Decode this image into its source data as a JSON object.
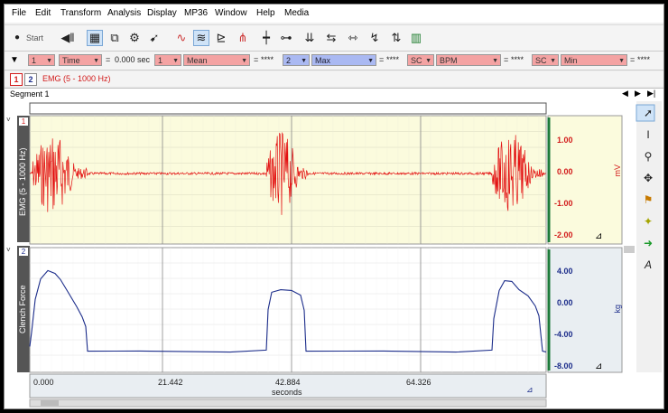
{
  "menu": [
    "File",
    "Edit",
    "Transform",
    "Analysis",
    "Display",
    "MP36",
    "Window",
    "Help",
    "Media"
  ],
  "toolbar": {
    "start_label": "Start",
    "icons": [
      "start-icon",
      "rewind-icon",
      "grid-icon",
      "graph-select-icon",
      "gear-icon",
      "pointer-wand-icon",
      "waveform-icon",
      "overlap-icon",
      "chart-icon",
      "split-icon",
      "marker-icon",
      "nodes-icon",
      "compress-icon",
      "expand-icon",
      "stretch-icon",
      "recycle-icon",
      "bar-chart-icon"
    ]
  },
  "measurements": [
    {
      "channel": "1",
      "measure": "Time",
      "value": "0.000 sec",
      "style": "red"
    },
    {
      "channel": "1",
      "measure": "Mean",
      "value": "****",
      "style": "red"
    },
    {
      "channel": "2",
      "measure": "Max",
      "value": "****",
      "style": "blue"
    },
    {
      "channel": "SC",
      "measure": "BPM",
      "value": "****",
      "style": "red"
    },
    {
      "channel": "SC",
      "measure": "Min",
      "value": "****",
      "style": "red"
    }
  ],
  "channels_row": {
    "ch1": "1",
    "ch2": "2",
    "label": "EMG (5 - 1000 Hz)",
    "label_color": "#d21a1a"
  },
  "segment": {
    "label": "Segment 1"
  },
  "ch1": {
    "number": "1",
    "name": "EMG (5 - 1000 Hz)",
    "unit": "mV",
    "ticks": [
      "1.00",
      "0.00",
      "-1.00",
      "-2.00"
    ],
    "color": "#e31212",
    "bg": "#fbfbdd"
  },
  "ch2": {
    "number": "2",
    "name": "Clench Force",
    "unit": "kg",
    "ticks": [
      "4.00",
      "0.00",
      "-4.00",
      "-8.00"
    ],
    "color": "#1b2c8a",
    "bg": "#ffffff"
  },
  "xaxis": {
    "ticks": [
      "0.000",
      "21.442",
      "42.884",
      "64.326"
    ],
    "label": "seconds"
  },
  "right_tools": [
    "arrow-pointer-icon",
    "i-beam-icon",
    "zoom-icon",
    "move-icon",
    "flag-icon",
    "wand-icon",
    "arrow-right-icon",
    "font-icon"
  ]
}
